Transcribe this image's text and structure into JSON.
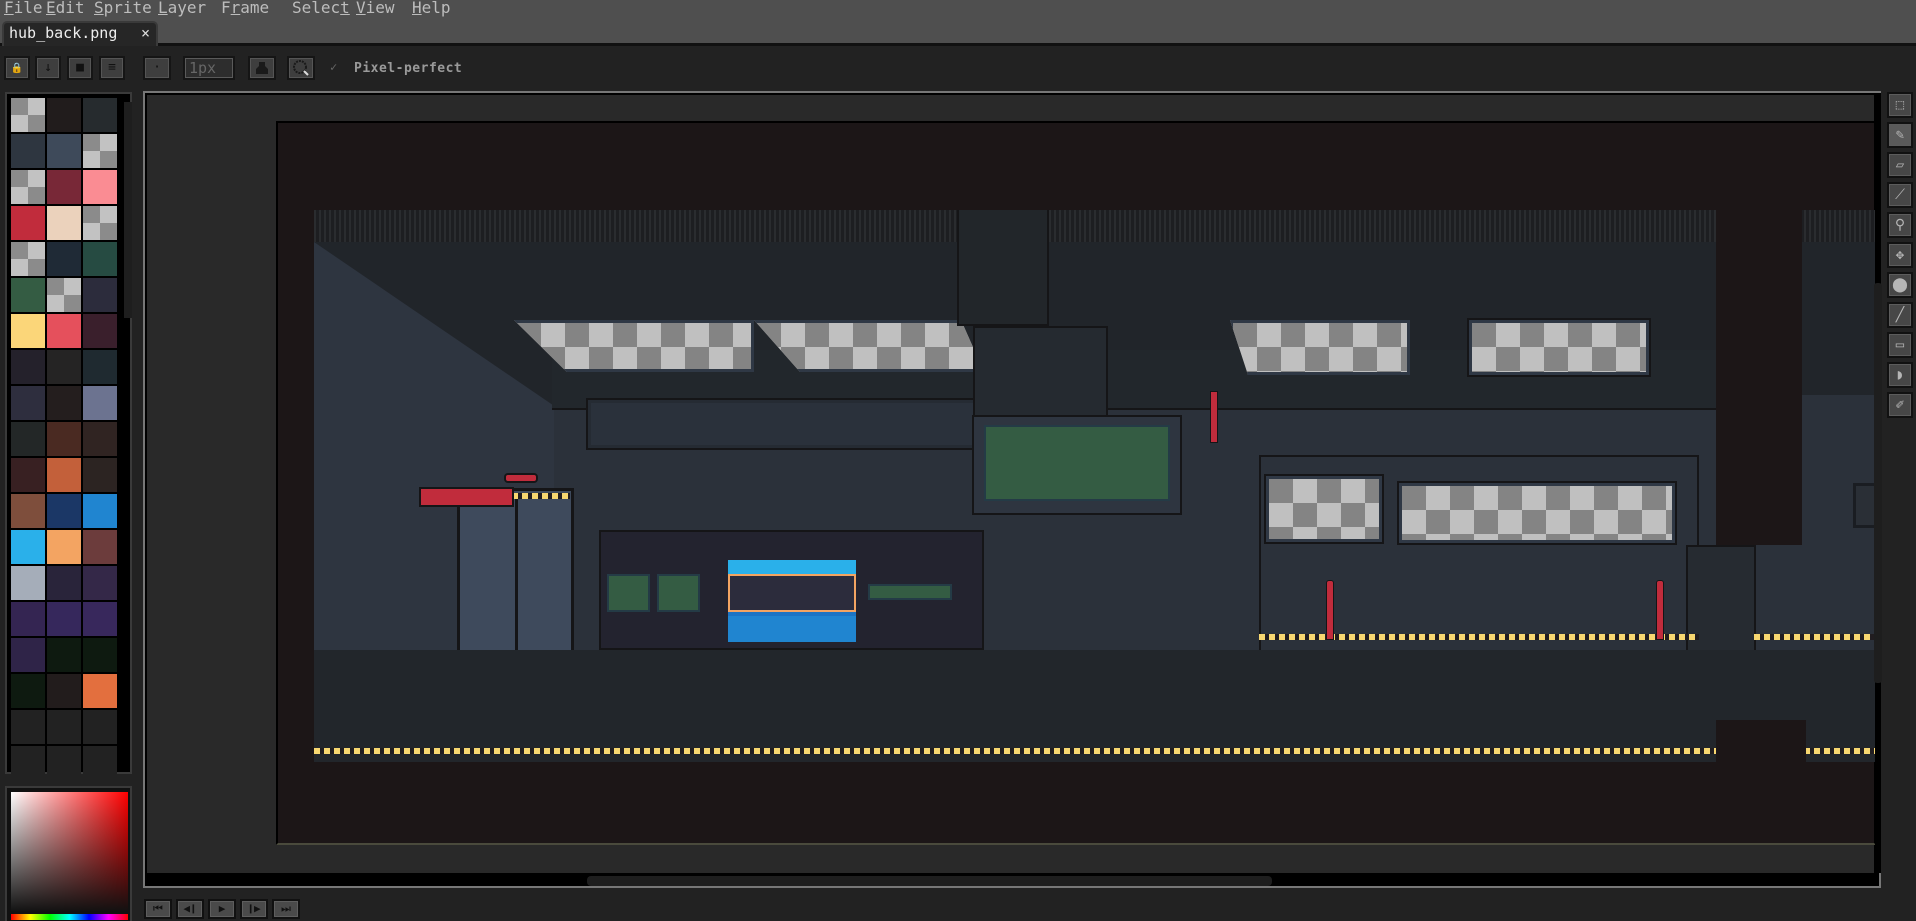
{
  "menu": [
    {
      "label": "File",
      "key": "F",
      "rest": "ile"
    },
    {
      "label": "Edit",
      "key": "E",
      "rest": "dit"
    },
    {
      "label": "Sprite",
      "key": "S",
      "rest": "prite"
    },
    {
      "label": "Layer",
      "key": "L",
      "rest": "ayer"
    },
    {
      "label": "Frame",
      "pre": "F",
      "key": "r",
      "rest": "ame"
    },
    {
      "label": "Select",
      "pre": "Selec",
      "key": "t",
      "rest": ""
    },
    {
      "label": "View",
      "key": "V",
      "rest": "iew"
    },
    {
      "label": "Help",
      "key": "H",
      "rest": "elp"
    }
  ],
  "tab": {
    "title": "hub_back.png",
    "close": "×"
  },
  "toolbar": {
    "lock_icon": "🔒",
    "down_icon": "↓",
    "square_icon": "■",
    "menu_icon": "≡",
    "dot_icon": "·",
    "brush_size": "1px",
    "pixel_perfect_checked": "✓",
    "pixel_perfect_label": "Pixel-perfect"
  },
  "palette": {
    "swatches": [
      "transparent",
      "#211c1c",
      "#262b2e",
      "#2e3640",
      "#3e4a5a",
      "transparent",
      "transparent",
      "#782837",
      "#fa8c93",
      "#c12c3c",
      "#ebd2bc",
      "transparent",
      "transparent",
      "#1f2a36",
      "#264b42",
      "#345c43",
      "transparent",
      "#2c2c3c",
      "#fbd679",
      "#e5505c",
      "#3a1f2c",
      "#24212b",
      "#252424",
      "#1f2a30",
      "#2e2e3e",
      "#241e1e",
      "#6c7390",
      "#232727",
      "#4a2a22",
      "#302422",
      "#382022",
      "#c3603a",
      "#2c2422",
      "#7e4e3c",
      "#1b3766",
      "#2085d0",
      "#2ab0ea",
      "#f3a462",
      "#6c3c3c",
      "#a5adb9",
      "#29243a",
      "#342848",
      "#342552",
      "#36285c",
      "#38285c",
      "#2f2448",
      "#0e1a10",
      "#0e1a10",
      "#0e1a10",
      "#221c1c",
      "#e36f3e",
      "#222222",
      "#222222",
      "#222222",
      "#222222",
      "#222222",
      "#222222"
    ]
  },
  "tools": [
    {
      "name": "rectangular-marquee",
      "icon": "⬚"
    },
    {
      "name": "pencil",
      "icon": "✎"
    },
    {
      "name": "eraser",
      "icon": "▱"
    },
    {
      "name": "eyedropper",
      "icon": "⟋"
    },
    {
      "name": "zoom",
      "icon": "⚲"
    },
    {
      "name": "move",
      "icon": "✥"
    },
    {
      "name": "paint-bucket",
      "icon": "⬤"
    },
    {
      "name": "line",
      "icon": "╱"
    },
    {
      "name": "rectangle",
      "icon": "▭"
    },
    {
      "name": "lasso",
      "icon": "◗"
    },
    {
      "name": "spray",
      "icon": "✐"
    }
  ],
  "frame_controls": [
    {
      "name": "first-frame",
      "icon": "⏮"
    },
    {
      "name": "previous-frame",
      "icon": "◀❙"
    },
    {
      "name": "play",
      "icon": "▶"
    },
    {
      "name": "next-frame",
      "icon": "❙▶"
    },
    {
      "name": "last-frame",
      "icon": "⏭"
    }
  ],
  "colors": {
    "accent_red": "#c12c3c",
    "hazard_yellow": "#f7d770",
    "monitor_green": "#345c43",
    "pod_blue": "#2ab0ea"
  }
}
